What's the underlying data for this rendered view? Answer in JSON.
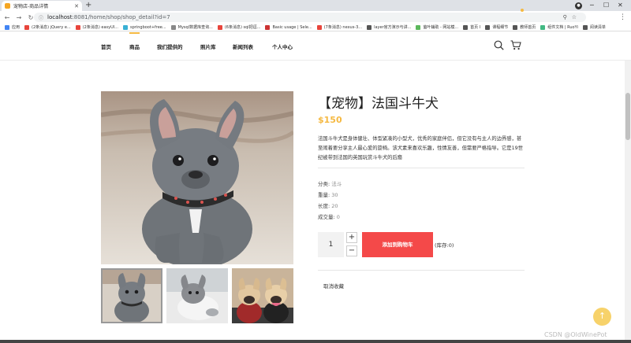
{
  "browser": {
    "tab_title": "宠物店-商品详情",
    "url_host": "localhost",
    "url_path": ":8081/home/shop/shop_detail?id=7",
    "bookmarks": [
      {
        "label": "应用",
        "color": "#4285f4"
      },
      {
        "label": "(2条消息) jQuery e...",
        "color": "#e8453c"
      },
      {
        "label": "(2条消息) easyUI...",
        "color": "#e8453c"
      },
      {
        "label": "springboot+free...",
        "color": "#39b0d4"
      },
      {
        "label": "Mysql数据库查询...",
        "color": "#888888"
      },
      {
        "label": "(6条消息) sql把逗...",
        "color": "#e8453c"
      },
      {
        "label": "Basic usage | Sele...",
        "color": "#cc3333"
      },
      {
        "label": "(7条消息) nexus-3...",
        "color": "#e8453c"
      },
      {
        "label": "layer官方演示与讲...",
        "color": "#555555"
      },
      {
        "label": "萤叶辅助 - 网站模...",
        "color": "#5cb85c"
      },
      {
        "label": "首页 I",
        "color": "#555555"
      },
      {
        "label": "课程细节",
        "color": "#555555"
      },
      {
        "label": "教师首页",
        "color": "#555555"
      },
      {
        "label": "组件文档 | RuoYi",
        "color": "#42b983"
      },
      {
        "label": "阅读清单",
        "color": "#555555"
      }
    ]
  },
  "nav": {
    "items": [
      "首页",
      "商品",
      "我们提供的",
      "照片库",
      "新闻列表",
      "个人中心"
    ]
  },
  "product": {
    "title": "【宠物】法国斗牛犬",
    "price": "$150",
    "description": "法国斗牛犬是身体健壮、体型紧凑的小型犬，优秀的家庭伴侣，但它没有与主人的边界感，甚至闹着要分享主人最心爱的旋椅。该犬素来喜欢乐趣，性情友善，但需要严格指导。它是19世纪被带到法国的英国玩赏斗牛犬的后裔",
    "category_label": "分类:",
    "category_value": "法斗",
    "weight_label": "重量:",
    "weight_value": "30",
    "length_label": "长度:",
    "length_value": "20",
    "sold_label": "成交量:",
    "sold_value": "0",
    "quantity": "1",
    "plus": "+",
    "minus": "−",
    "add_to_cart": "添加到购物车",
    "stock": "(库存:0)",
    "favorite": "取消收藏"
  },
  "back_to_top": "↑",
  "watermark": "CSDN @OldWinePot",
  "colors": {
    "accent": "#f5b942",
    "cart_button": "#f44949"
  }
}
